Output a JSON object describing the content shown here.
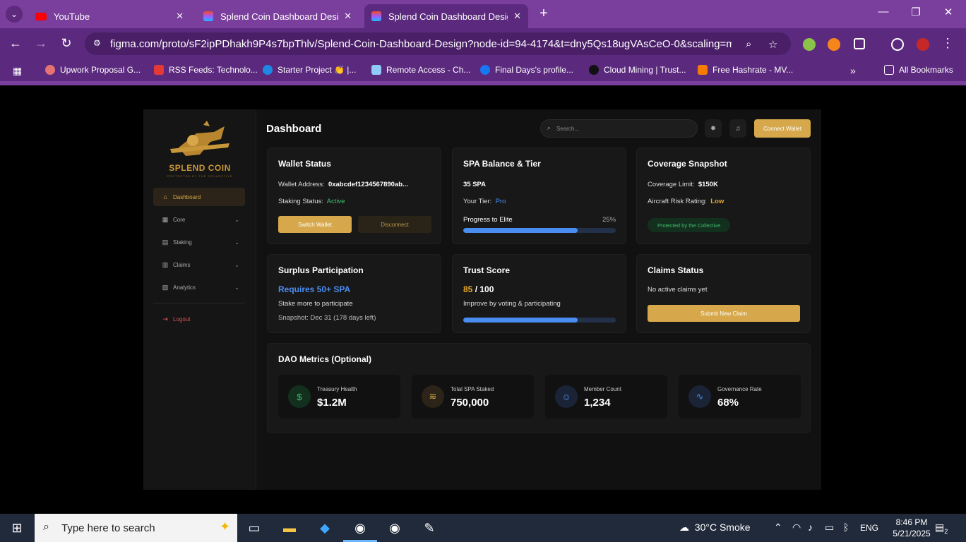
{
  "browser": {
    "tabs": [
      {
        "title": "YouTube",
        "active": false
      },
      {
        "title": "Splend Coin Dashboard Design",
        "active": false
      },
      {
        "title": "Splend Coin Dashboard Design",
        "active": true
      }
    ],
    "url": "figma.com/proto/sF2ipPDhakh9P4s7bpThlv/Splend-Coin-Dashboard-Design?node-id=94-4174&t=dny5Qs18ugVAsCeO-0&scaling=min-zoo...",
    "bookmarks": [
      "Upwork Proposal G...",
      "RSS Feeds: Technolo...",
      "Starter Project 👏 |...",
      "Remote Access - Ch...",
      "Final Days's profile...",
      "Cloud Mining | Trust...",
      "Free Hashrate - MV..."
    ],
    "all_bookmarks": "All Bookmarks"
  },
  "sidebar": {
    "logo_text": "SPLEND COIN",
    "logo_sub": "PROTECTED BY THE COLLECTIVE",
    "items": [
      {
        "label": "Dashboard"
      },
      {
        "label": "Core"
      },
      {
        "label": "Staking"
      },
      {
        "label": "Claims"
      },
      {
        "label": "Analytics"
      }
    ],
    "logout": "Logout"
  },
  "header": {
    "title": "Dashboard",
    "search_placeholder": "Search...",
    "connect_label": "Connect Wallet"
  },
  "wallet": {
    "title": "Wallet Status",
    "address_label": "Wallet Address:",
    "address": "0xabcdef1234567890ab...",
    "staking_label": "Staking Status:",
    "staking_value": "Active",
    "switch_label": "Switch Wallet",
    "disconnect_label": "Disconnect"
  },
  "balance": {
    "title": "SPA Balance & Tier",
    "amount": "35 SPA",
    "tier_label": "Your Tier:",
    "tier_value": "Pro",
    "progress_label": "Progress to Elite",
    "progress_pct_text": "25%",
    "progress_fraction": 0.75
  },
  "coverage": {
    "title": "Coverage Snapshot",
    "limit_label": "Coverage Limit:",
    "limit_value": "$150K",
    "risk_label": "Aircraft Risk Rating:",
    "risk_value": "Low",
    "badge": "Protected by the Collective"
  },
  "surplus": {
    "title": "Surplus Participation",
    "requirement": "Requires 50+ SPA",
    "hint": "Stake more to participate",
    "snapshot": "Snapshot: Dec 31 (178 days left)"
  },
  "trust": {
    "title": "Trust Score",
    "score": "85",
    "max": "/ 100",
    "hint": "Improve by voting & participating",
    "progress_fraction": 0.75
  },
  "claims": {
    "title": "Claims Status",
    "status": "No active claims yet",
    "submit_label": "Submit New Claim"
  },
  "dao": {
    "title": "DAO Metrics (Optional)",
    "metrics": [
      {
        "label": "Treasury Health",
        "value": "$1.2M",
        "icon": "dollar-icon",
        "color": "#3fbf6a"
      },
      {
        "label": "Total SPA Staked",
        "value": "750,000",
        "icon": "layers-icon",
        "color": "#d6a84b"
      },
      {
        "label": "Member Count",
        "value": "1,234",
        "icon": "users-icon",
        "color": "#4a8df0"
      },
      {
        "label": "Governance Rate",
        "value": "68%",
        "icon": "activity-icon",
        "color": "#4a8df0"
      }
    ]
  },
  "taskbar": {
    "search_placeholder": "Type here to search",
    "weather": "30°C  Smoke",
    "lang": "ENG",
    "time": "8:46 PM",
    "date": "5/21/2025",
    "notifications": "2"
  },
  "colors": {
    "accent": "#d6a84b",
    "browser": "#7a3e9d",
    "success": "#3fbf6a",
    "info": "#4a8df0"
  }
}
